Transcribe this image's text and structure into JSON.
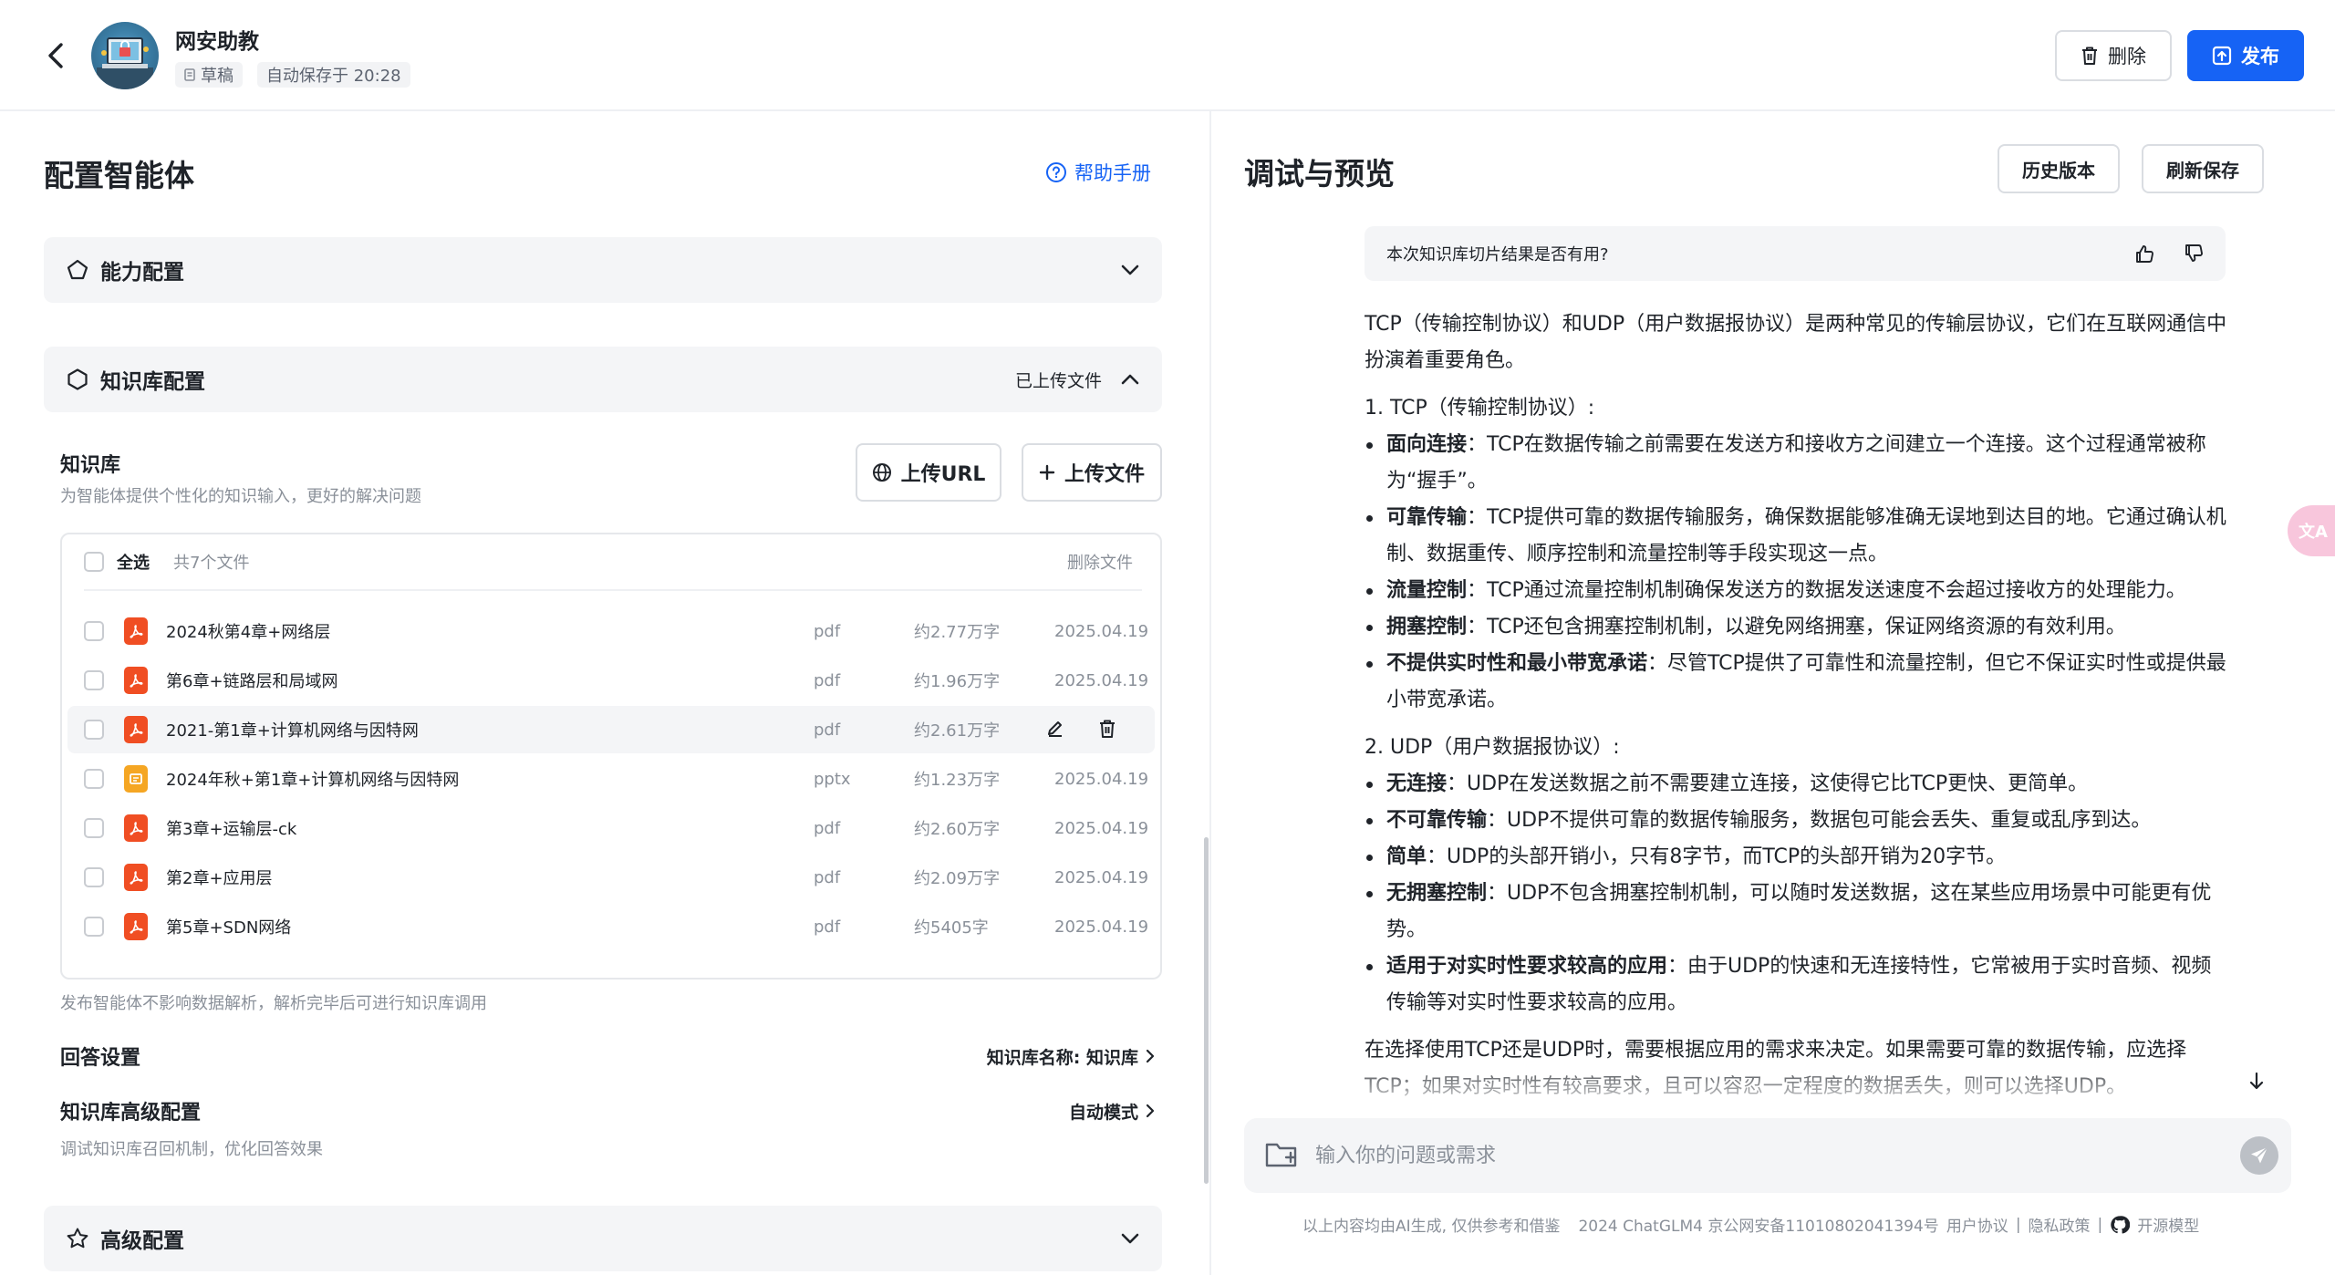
{
  "header": {
    "agent_name": "网安助教",
    "status_badge": "草稿",
    "autosave": "自动保存于 20:28",
    "delete_label": "删除",
    "publish_label": "发布"
  },
  "left": {
    "title": "配置智能体",
    "help_label": "帮助手册",
    "sections": {
      "capability": "能力配置",
      "knowledge": "知识库配置",
      "knowledge_status": "已上传文件",
      "advanced": "高级配置"
    },
    "kb": {
      "label": "知识库",
      "desc": "为智能体提供个性化的知识输入，更好的解决问题",
      "upload_url": "上传URL",
      "upload_file": "上传文件",
      "select_all": "全选",
      "count": "共7个文件",
      "delete_files": "删除文件",
      "files": [
        {
          "name": "2024秋第4章+网络层",
          "type": "pdf",
          "size": "约2.77万字",
          "date": "2025.04.19"
        },
        {
          "name": "第6章+链路层和局域网",
          "type": "pdf",
          "size": "约1.96万字",
          "date": "2025.04.19"
        },
        {
          "name": "2021-第1章+计算机网络与因特网",
          "type": "pdf",
          "size": "约2.61万字",
          "date": ""
        },
        {
          "name": "2024年秋+第1章+计算机网络与因特网",
          "type": "pptx",
          "size": "约1.23万字",
          "date": "2025.04.19"
        },
        {
          "name": "第3章+运输层-ck",
          "type": "pdf",
          "size": "约2.60万字",
          "date": "2025.04.19"
        },
        {
          "name": "第2章+应用层",
          "type": "pdf",
          "size": "约2.09万字",
          "date": "2025.04.19"
        },
        {
          "name": "第5章+SDN网络",
          "type": "pdf",
          "size": "约5405字",
          "date": "2025.04.19"
        }
      ],
      "note": "发布智能体不影响数据解析，解析完毕后可进行知识库调用"
    },
    "answer_settings": {
      "label": "回答设置",
      "value": "知识库名称: 知识库"
    },
    "kb_advanced": {
      "label": "知识库高级配置",
      "value": "自动模式",
      "desc": "调试知识库召回机制，优化回答效果"
    }
  },
  "right": {
    "title": "调试与预览",
    "history_label": "历史版本",
    "refresh_label": "刷新保存",
    "feedback_question": "本次知识库切片结果是否有用?",
    "answer": {
      "intro": "TCP（传输控制协议）和UDP（用户数据报协议）是两种常见的传输层协议，它们在互联网通信中扮演着重要角色。",
      "tcp_heading": "1. TCP（传输控制协议）:",
      "tcp_items": [
        {
          "k": "面向连接",
          "v": "：TCP在数据传输之前需要在发送方和接收方之间建立一个连接。这个过程通常被称为“握手”。"
        },
        {
          "k": "可靠传输",
          "v": "：TCP提供可靠的数据传输服务，确保数据能够准确无误地到达目的地。它通过确认机制、数据重传、顺序控制和流量控制等手段实现这一点。"
        },
        {
          "k": "流量控制",
          "v": "：TCP通过流量控制机制确保发送方的数据发送速度不会超过接收方的处理能力。"
        },
        {
          "k": "拥塞控制",
          "v": "：TCP还包含拥塞控制机制，以避免网络拥塞，保证网络资源的有效利用。"
        },
        {
          "k": "不提供实时性和最小带宽承诺",
          "v": "：尽管TCP提供了可靠性和流量控制，但它不保证实时性或提供最小带宽承诺。"
        }
      ],
      "udp_heading": "2. UDP（用户数据报协议）:",
      "udp_items": [
        {
          "k": "无连接",
          "v": "：UDP在发送数据之前不需要建立连接，这使得它比TCP更快、更简单。"
        },
        {
          "k": "不可靠传输",
          "v": "：UDP不提供可靠的数据传输服务，数据包可能会丢失、重复或乱序到达。"
        },
        {
          "k": "简单",
          "v": "：UDP的头部开销小，只有8字节，而TCP的头部开销为20字节。"
        },
        {
          "k": "无拥塞控制",
          "v": "：UDP不包含拥塞控制机制，可以随时发送数据，这在某些应用场景中可能更有优势。"
        },
        {
          "k": "适用于对实时性要求较高的应用",
          "v": "：由于UDP的快速和无连接特性，它常被用于实时音频、视频传输等对实时性要求较高的应用。"
        }
      ],
      "conclusion": "在选择使用TCP还是UDP时，需要根据应用的需求来决定。如果需要可靠的数据传输，应选择TCP；如果对实时性有较高要求，且可以容忍一定程度的数据丢失，则可以选择UDP。"
    },
    "input_placeholder": "输入你的问题或需求",
    "footer": {
      "disclaimer": "以上内容均由AI生成, 仅供参考和借鉴",
      "copyright": "2024 ChatGLM4 京公网安备11010802041394号",
      "user_agreement": "用户协议",
      "sep": "|",
      "privacy": "隐私政策",
      "open_model": "开源模型"
    },
    "translate_label": "文A"
  },
  "colors": {
    "primary": "#1663f5",
    "pdf": "#f04e23",
    "pptx": "#f5a623"
  }
}
